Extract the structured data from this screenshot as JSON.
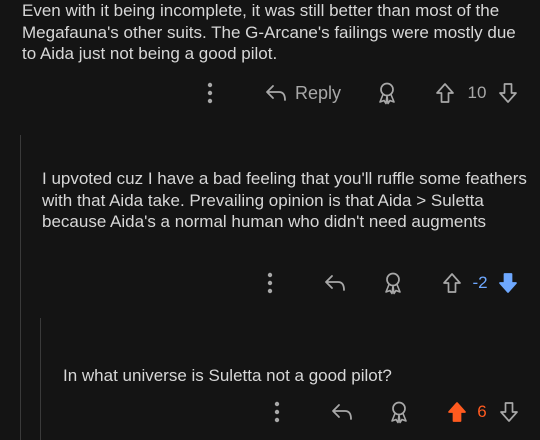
{
  "comments": [
    {
      "text": "Even with it being incomplete, it was still better than most of the Megafauna's other suits. The G-Arcane's failings were mostly due to Aida just not being a good pilot.",
      "reply_label": "Reply",
      "score": "10",
      "vote_state": "none"
    },
    {
      "text": "I upvoted cuz I have a bad feeling that you'll ruffle some feathers with that Aida take. Prevailing opinion is that Aida > Suletta because Aida's a normal human who didn't need augments",
      "score": "-2",
      "vote_state": "downvoted"
    },
    {
      "text": "In what universe is Suletta not a good pilot?",
      "score": "6",
      "vote_state": "upvoted"
    }
  ],
  "colors": {
    "background": "#141414",
    "text": "#d7d7d7",
    "icon": "#a8a8a8",
    "upvote_active": "#ff5a1f",
    "downvote_active": "#6ea8ff",
    "thread_line": "#3a3a3a"
  },
  "icons": [
    "more-vertical-icon",
    "reply-arrow-icon",
    "award-icon",
    "upvote-arrow-icon",
    "downvote-arrow-icon"
  ]
}
